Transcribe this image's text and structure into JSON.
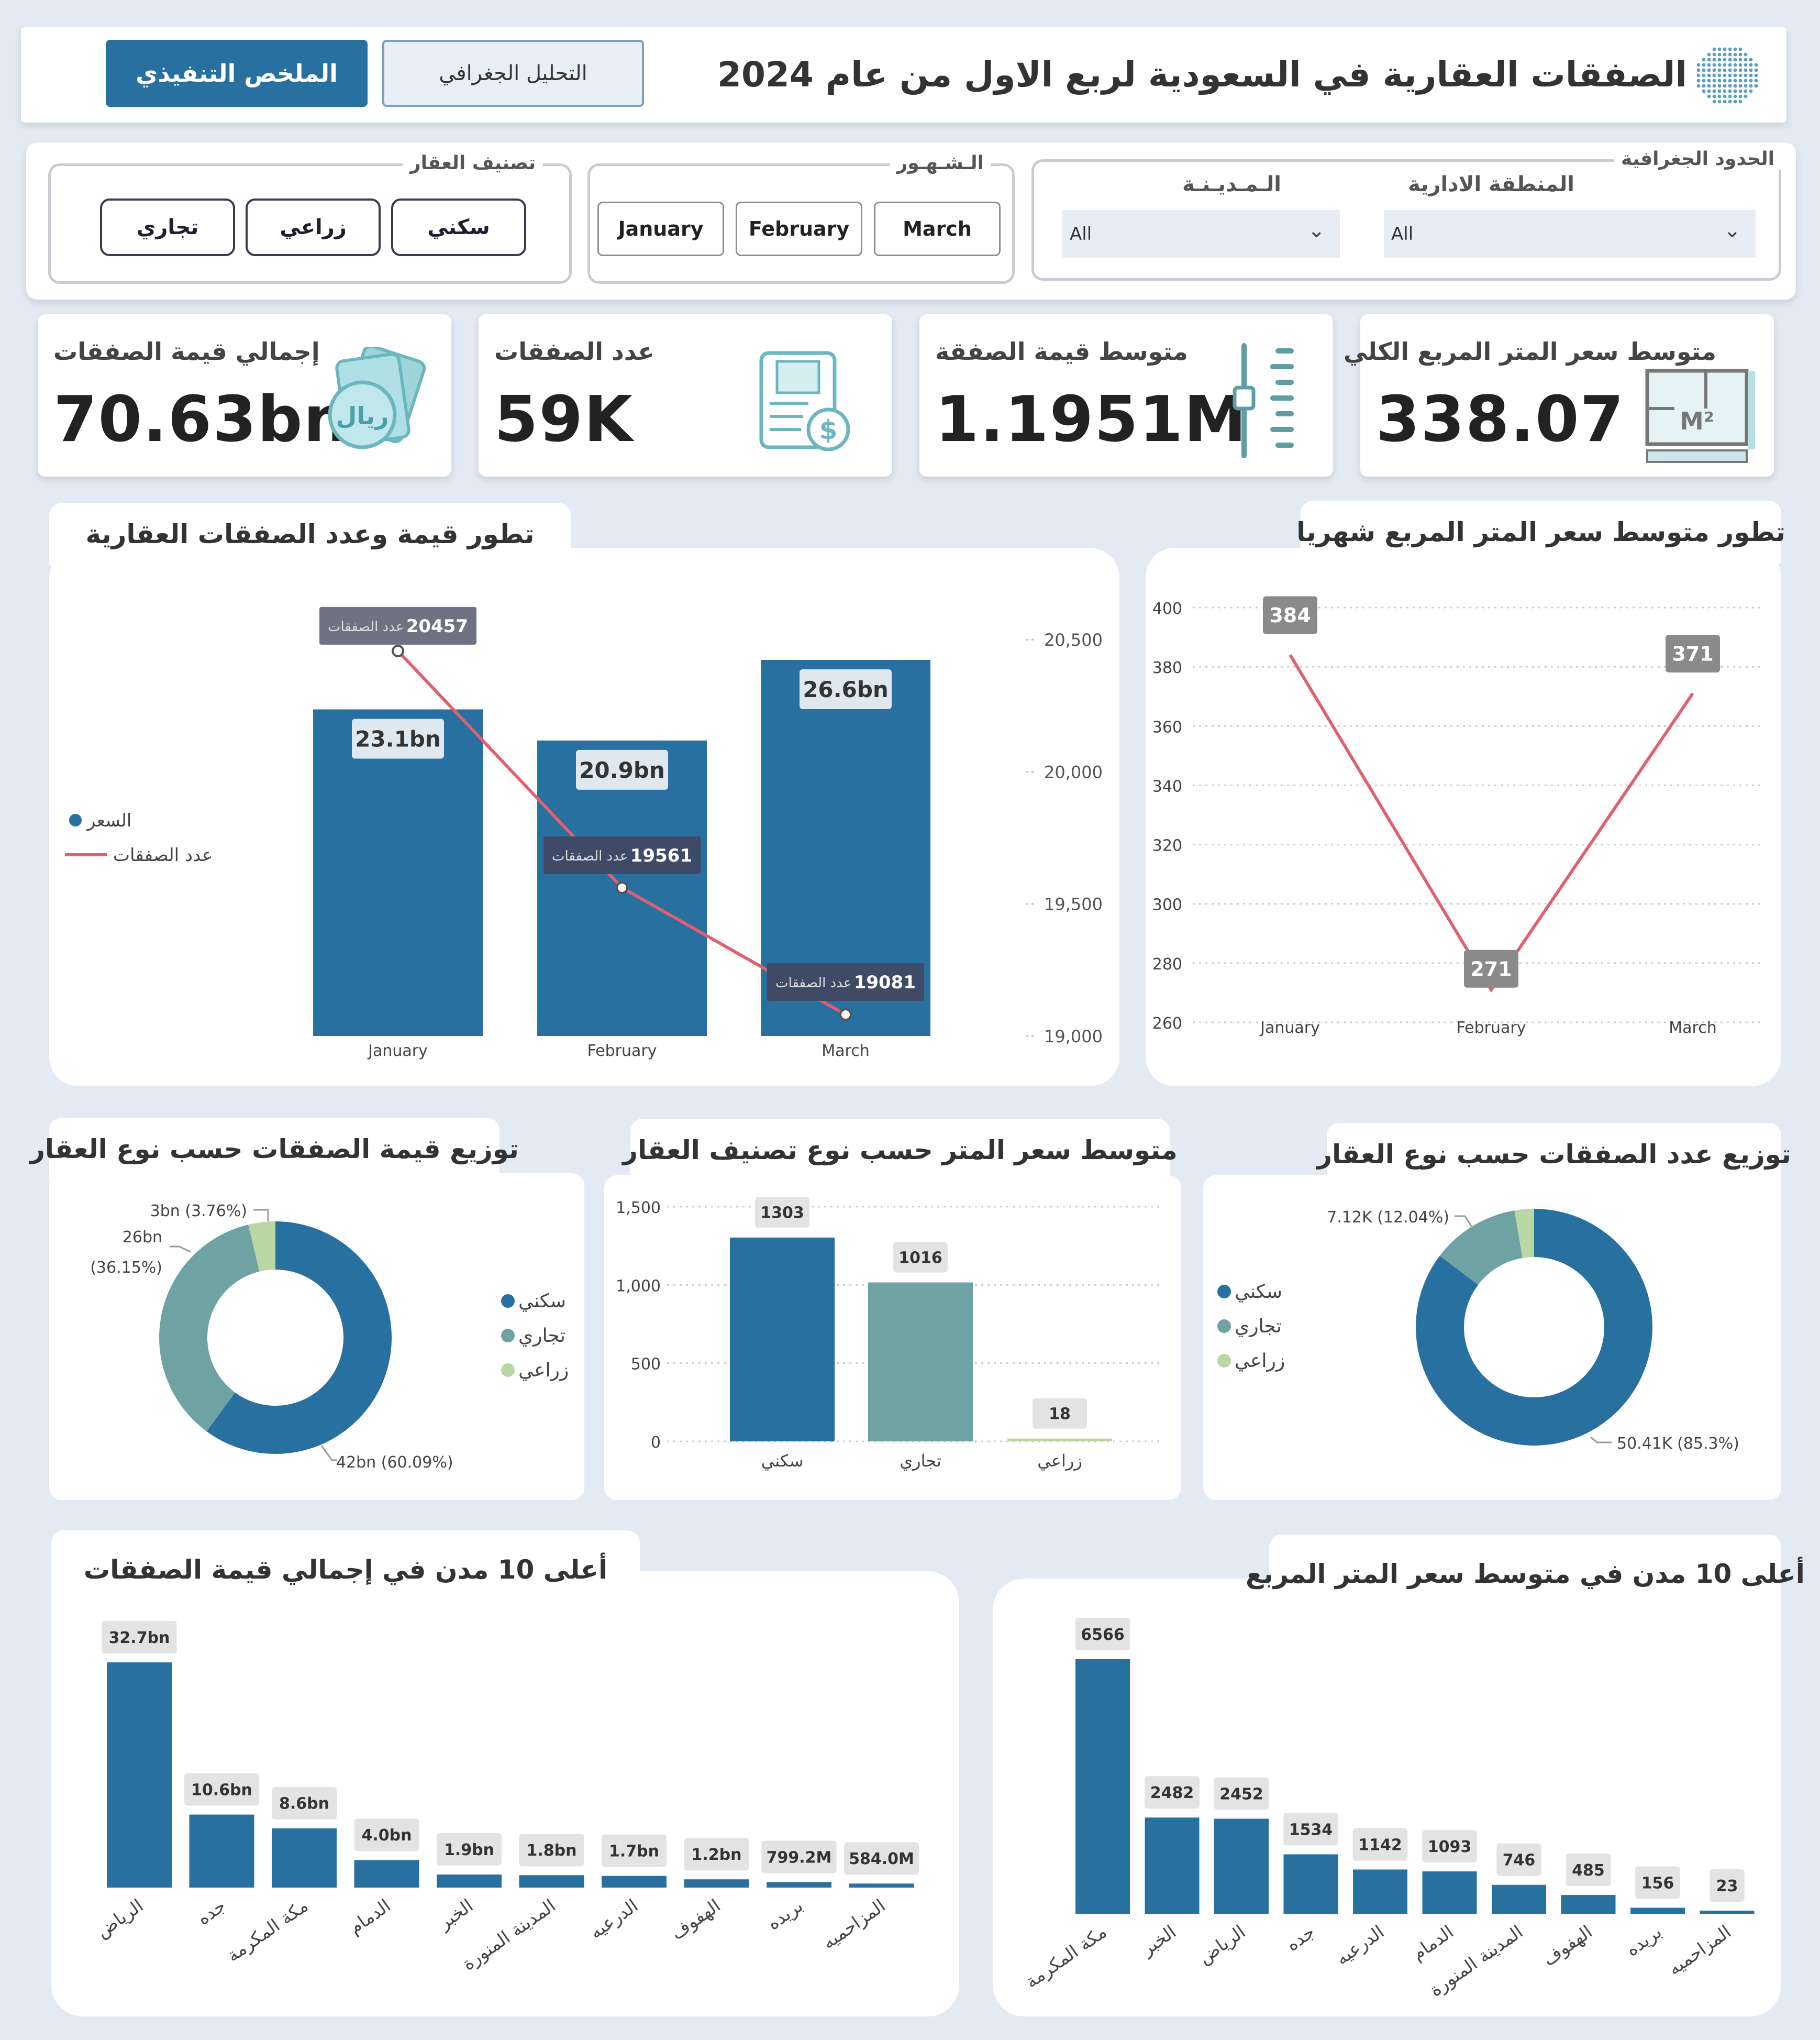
{
  "header": {
    "title": "الصفقات العقارية في السعودية لربع الاول من عام 2024",
    "nav_exec": "الملخص التنفيذي",
    "nav_geo": "التحليل الجغرافي"
  },
  "filters": {
    "type_legend": "تصنيف العقار",
    "types": [
      "سكني",
      "زراعي",
      "تجاري"
    ],
    "months_legend": "الـشـهـور",
    "months": [
      "March",
      "February",
      "January"
    ],
    "geo_legend": "الحدود الجغرافية",
    "region_label": "المنطقة الادارية",
    "region_value": "All",
    "city_label": "الـمـديـنـة",
    "city_value": "All"
  },
  "kpis": [
    {
      "title": "إجمالي قيمة الصفقات",
      "value": "70.63bn",
      "icon": "riyal-money-icon"
    },
    {
      "title": "عدد الصفقات",
      "value": "59K",
      "icon": "invoice-dollar-icon"
    },
    {
      "title": "متوسط قيمة الصفقة",
      "value": "1.1951M",
      "icon": "ruler-gauge-icon"
    },
    {
      "title": "متوسط سعر المتر المربع الكلي",
      "value": "338.07",
      "icon": "floor-plan-icon"
    }
  ],
  "titles": {
    "combo": "تطور قيمة وعدد الصفقات العقارية",
    "line": "تطور متوسط سعر المتر  المربع شهريا",
    "donut_value": "توزيع قيمة الصفقات حسب نوع العقار",
    "bar_type": "متوسط سعر المتر حسب نوع تصنيف العقار",
    "donut_count": "توزيع عدد الصفقات حسب نوع العقار",
    "top_value": "أعلى 10 مدن  في إجمالي قيمة الصفقات",
    "top_price": "أعلى 10 مدن  في متوسط  سعر المتر المربع"
  },
  "colors": {
    "primary": "#2870a0",
    "teal": "#6fa3a3",
    "light_green": "#b9d6a3",
    "line_red": "#e0606e",
    "header_dark": "#2870a0"
  },
  "chart_data": [
    {
      "id": "combo",
      "type": "bar",
      "categories": [
        "January",
        "February",
        "March"
      ],
      "series": [
        {
          "name": "السعر",
          "values": [
            23.1,
            20.9,
            26.6
          ],
          "labels": [
            "23.1bn",
            "20.9bn",
            "26.6bn"
          ]
        },
        {
          "name": "عدد الصفقات",
          "values": [
            20457,
            19561,
            19081
          ],
          "point_label": "عدد الصفقات"
        }
      ],
      "y2_ticks": [
        "20,500",
        "20,000",
        "19,500",
        "19,000"
      ],
      "y2_range": [
        19000,
        20550
      ]
    },
    {
      "id": "line",
      "type": "line",
      "categories": [
        "January",
        "February",
        "March"
      ],
      "values": [
        384,
        271,
        371
      ],
      "yticks": [
        400,
        380,
        360,
        340,
        320,
        300,
        280,
        260
      ],
      "ylim": [
        260,
        400
      ]
    },
    {
      "id": "donut_value",
      "type": "pie",
      "slices": [
        {
          "name": "سكني",
          "value": 60.09,
          "label": "42bn (60.09%)"
        },
        {
          "name": "تجاري",
          "value": 36.15,
          "label": "26bn",
          "label2": "(36.15%)"
        },
        {
          "name": "زراعي",
          "value": 3.76,
          "label": "3bn (3.76%)"
        }
      ]
    },
    {
      "id": "bar_type",
      "type": "bar",
      "categories": [
        "سكني",
        "تجاري",
        "زراعي"
      ],
      "values": [
        1303,
        1016,
        18
      ],
      "labels": [
        "1303",
        "1016",
        "18"
      ],
      "yticks": [
        "1,500",
        "1,000",
        "500",
        "0"
      ],
      "ylim": [
        0,
        1500
      ]
    },
    {
      "id": "donut_count",
      "type": "pie",
      "slices": [
        {
          "name": "سكني",
          "value": 85.3,
          "label": "50.41K (85.3%)"
        },
        {
          "name": "تجاري",
          "value": 12.04,
          "label": "7.12K (12.04%)"
        },
        {
          "name": "زراعي",
          "value": 2.66,
          "label": ""
        }
      ]
    },
    {
      "id": "top_value",
      "type": "bar",
      "categories": [
        "الرياض",
        "جده",
        "مكة المكرمة",
        "الدمام",
        "الخبر",
        "المدينة المنورة",
        "الدرعيه",
        "الهفوف",
        "بريده",
        "المزاحميه"
      ],
      "values": [
        32.7,
        10.6,
        8.6,
        4.0,
        1.9,
        1.8,
        1.7,
        1.2,
        0.7992,
        0.584
      ],
      "labels": [
        "32.7bn",
        "10.6bn",
        "8.6bn",
        "4.0bn",
        "1.9bn",
        "1.8bn",
        "1.7bn",
        "1.2bn",
        "799.2M",
        "584.0M"
      ]
    },
    {
      "id": "top_price",
      "type": "bar",
      "categories": [
        "مكة المكرمة",
        "الخبر",
        "الرياض",
        "جده",
        "الدرعيه",
        "الدمام",
        "المدينة المنورة",
        "الهفوف",
        "بريده",
        "المزاحميه"
      ],
      "values": [
        6566,
        2482,
        2452,
        1534,
        1142,
        1093,
        746,
        485,
        156,
        23
      ],
      "labels": [
        "6566",
        "2482",
        "2452",
        "1534",
        "1142",
        "1093",
        "746",
        "485",
        "156",
        "23"
      ]
    }
  ]
}
